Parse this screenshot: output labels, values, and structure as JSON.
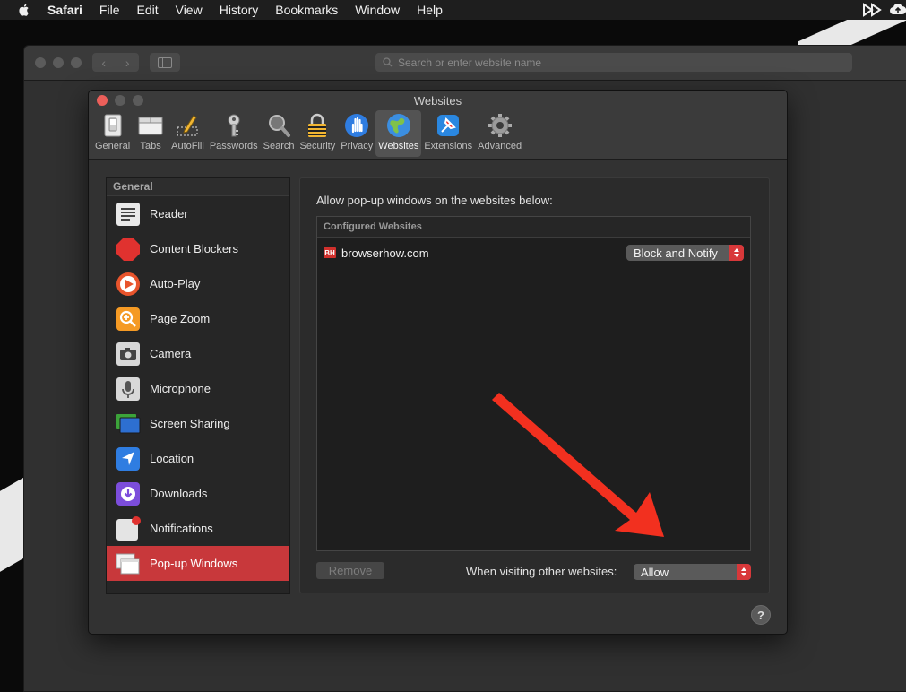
{
  "menubar": {
    "items": [
      "Safari",
      "File",
      "Edit",
      "View",
      "History",
      "Bookmarks",
      "Window",
      "Help"
    ]
  },
  "browser": {
    "address_placeholder": "Search or enter website name"
  },
  "prefs": {
    "title": "Websites",
    "tabs": [
      {
        "label": "General",
        "icon": "general-switch-icon"
      },
      {
        "label": "Tabs",
        "icon": "tabs-icon"
      },
      {
        "label": "AutoFill",
        "icon": "autofill-pencil-icon"
      },
      {
        "label": "Passwords",
        "icon": "key-icon"
      },
      {
        "label": "Search",
        "icon": "magnifier-icon"
      },
      {
        "label": "Security",
        "icon": "lock-icon"
      },
      {
        "label": "Privacy",
        "icon": "hand-icon"
      },
      {
        "label": "Websites",
        "icon": "globe-icon"
      },
      {
        "label": "Extensions",
        "icon": "extensions-icon"
      },
      {
        "label": "Advanced",
        "icon": "gear-icon"
      }
    ],
    "active_tab": "Websites",
    "sidebar": {
      "header": "General",
      "items": [
        {
          "label": "Reader",
          "icon": "reader-icon"
        },
        {
          "label": "Content Blockers",
          "icon": "stop-sign-icon"
        },
        {
          "label": "Auto-Play",
          "icon": "play-icon"
        },
        {
          "label": "Page Zoom",
          "icon": "zoom-icon"
        },
        {
          "label": "Camera",
          "icon": "camera-icon"
        },
        {
          "label": "Microphone",
          "icon": "microphone-icon"
        },
        {
          "label": "Screen Sharing",
          "icon": "screen-sharing-icon"
        },
        {
          "label": "Location",
          "icon": "location-icon"
        },
        {
          "label": "Downloads",
          "icon": "downloads-icon"
        },
        {
          "label": "Notifications",
          "icon": "notifications-icon"
        },
        {
          "label": "Pop-up Windows",
          "icon": "popup-windows-icon"
        }
      ],
      "selected": "Pop-up Windows"
    },
    "panel": {
      "lead": "Allow pop-up windows on the websites below:",
      "configured_header": "Configured Websites",
      "sites": [
        {
          "favicon": "BH",
          "name": "browserhow.com",
          "setting": "Block and Notify"
        }
      ],
      "remove_label": "Remove",
      "other_label": "When visiting other websites:",
      "other_value": "Allow"
    },
    "help_label": "?"
  },
  "colors": {
    "accent": "#d8383a",
    "selection": "#c8383b",
    "annotation_arrow": "#f2301f"
  }
}
